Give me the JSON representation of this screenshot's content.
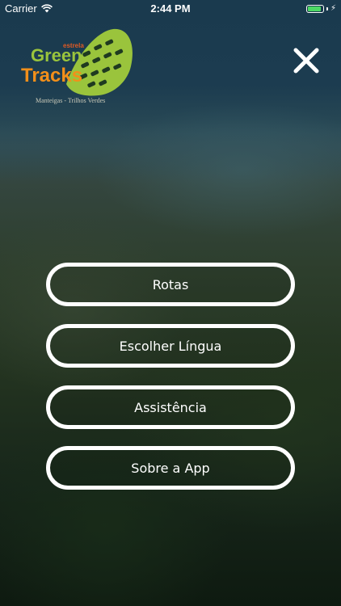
{
  "status_bar": {
    "carrier": "Carrier",
    "time": "2:44 PM",
    "battery_level": 0.9
  },
  "logo": {
    "word_estrela": "estrela",
    "word_green": "Green",
    "word_tracks": "Tracks",
    "subtitle": "Manteigas - Trilhos Verdes"
  },
  "close_icon": "close-icon",
  "menu": {
    "items": [
      {
        "label": "Rotas"
      },
      {
        "label": "Escolher Língua"
      },
      {
        "label": "Assistência"
      },
      {
        "label": "Sobre a App"
      }
    ]
  },
  "colors": {
    "button_border": "#ffffff",
    "logo_green": "#9ac43c",
    "logo_orange": "#f28f1a",
    "battery_green": "#4cd964"
  }
}
